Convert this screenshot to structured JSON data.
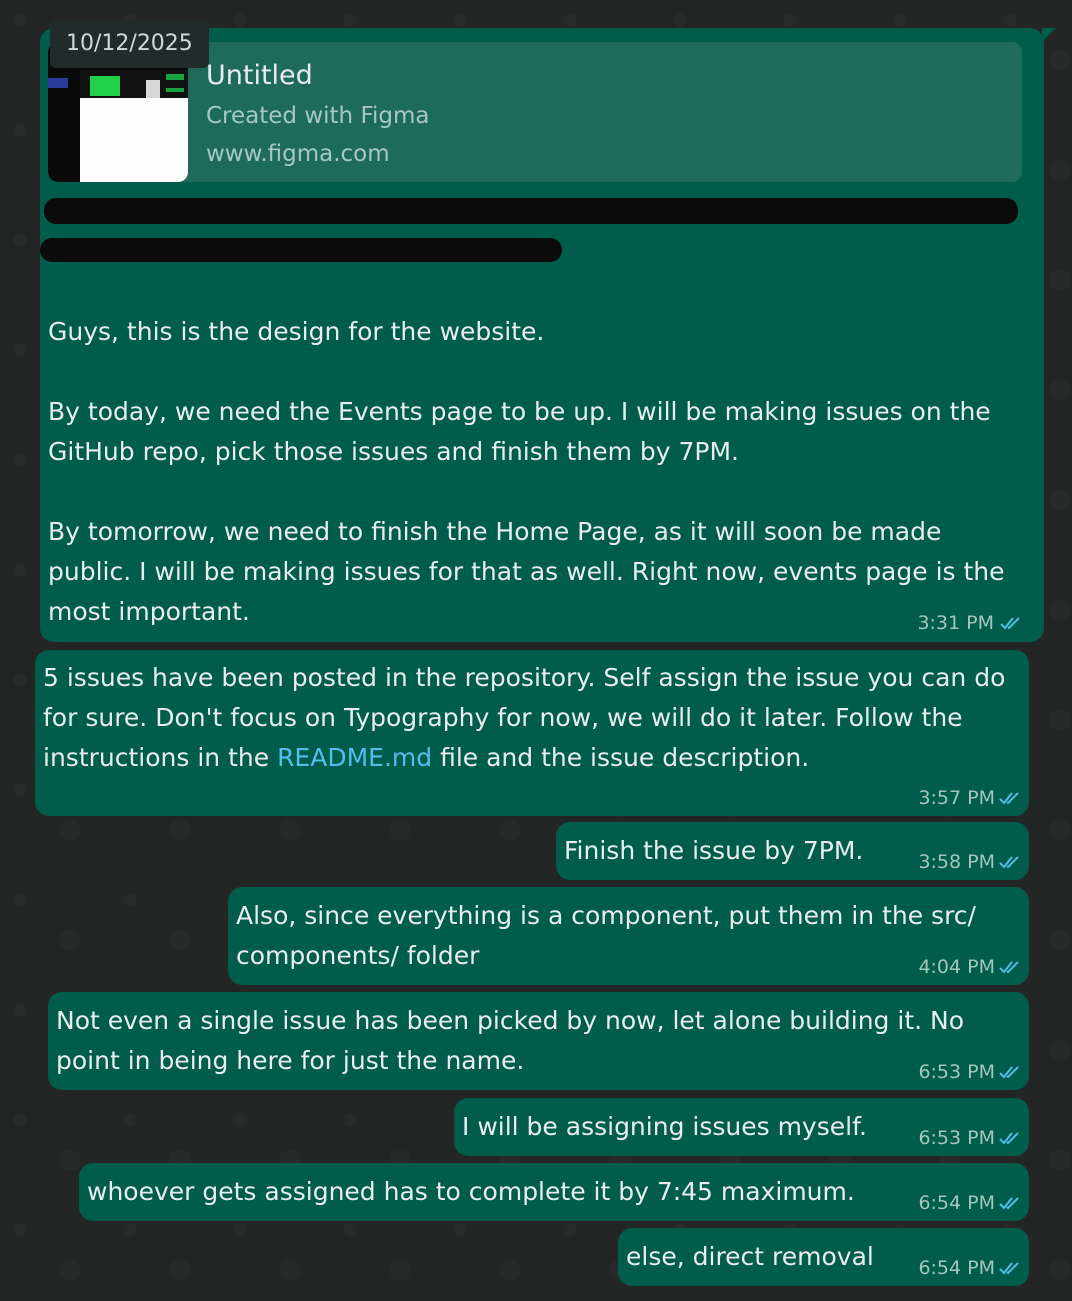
{
  "date_chip": "10/12/2025",
  "link_preview": {
    "title": "Untitled",
    "subtitle": "Created with Figma",
    "domain": "www.figma.com"
  },
  "messages": [
    {
      "paragraphs": [
        "Guys, this is the design for the website.",
        "By today, we need the Events page to be up. I will be making issues on the GitHub repo, pick those issues and finish them by 7PM.",
        "By tomorrow, we need to finish the Home Page, as it will soon be made public. I will be making issues for that as well. Right now, events page is the most important."
      ],
      "time": "3:31 PM"
    },
    {
      "before_link": "5 issues have been posted in the repository. Self assign the issue you can do for sure. Don't focus on Typography for now, we will do it later. Follow the instructions in the ",
      "link": "README.md",
      "after_link": " file and the issue description.",
      "time": "3:57 PM"
    },
    {
      "text": "Finish the issue by 7PM.",
      "time": "3:58 PM"
    },
    {
      "text": "Also, since everything is a component, put them in the src/ components/ folder",
      "time": "4:04 PM"
    },
    {
      "text": "Not even a single issue has been picked by now, let alone building it. No point in being here for just the name.",
      "time": "6:53 PM"
    },
    {
      "text": "I will be assigning issues myself.",
      "time": "6:53 PM"
    },
    {
      "text": "whoever gets assigned has to complete it by 7:45 maximum.",
      "time": "6:54 PM"
    },
    {
      "text": "else, direct removal",
      "time": "6:54 PM"
    }
  ],
  "colors": {
    "background": "#242626",
    "outgoing_bubble": "#005c4b",
    "read_ticks": "#53bdeb",
    "link": "#53bdeb"
  },
  "icons": {
    "read_receipt": "double-check-icon"
  }
}
